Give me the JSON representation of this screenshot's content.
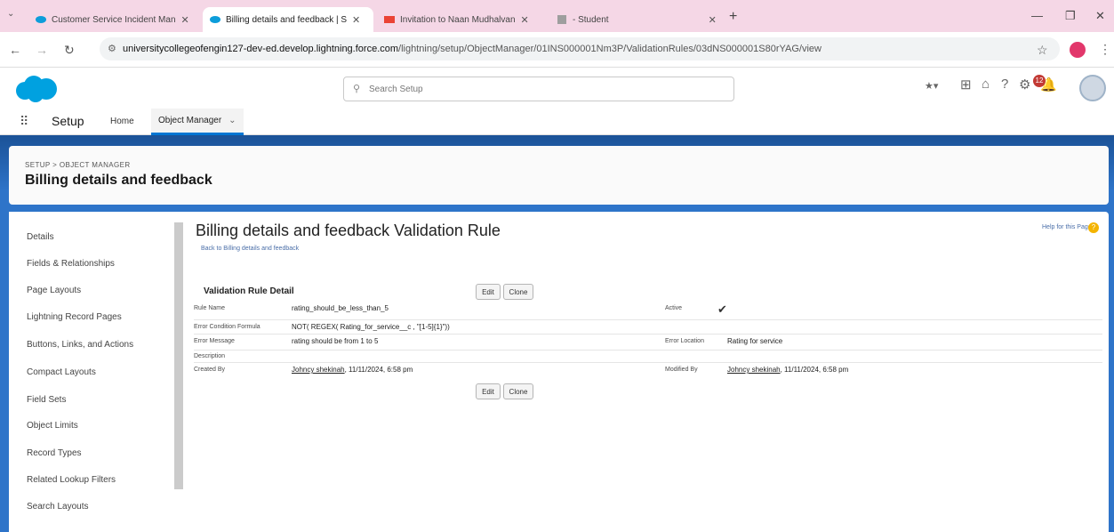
{
  "browser": {
    "tabs": [
      {
        "title": "Customer Service Incident Man",
        "active": false
      },
      {
        "title": "Billing details and feedback | S",
        "active": true
      },
      {
        "title": "Invitation to Naan Mudhalvan",
        "active": false
      },
      {
        "title": "- Student",
        "active": false
      }
    ],
    "url_host": "universitycollegeofengin127-dev-ed.develop.lightning.force.com",
    "url_path": "/lightning/setup/ObjectManager/01INS000001Nm3P/ValidationRules/03dNS000001S80rYAG/view"
  },
  "header": {
    "search_placeholder": "Search Setup",
    "notification_count": "12"
  },
  "appnav": {
    "app_name": "Setup",
    "home": "Home",
    "object_manager": "Object Manager"
  },
  "object_header": {
    "breadcrumb": "SETUP > OBJECT MANAGER",
    "title": "Billing details and feedback"
  },
  "sidebar": {
    "items": [
      "Details",
      "Fields & Relationships",
      "Page Layouts",
      "Lightning Record Pages",
      "Buttons, Links, and Actions",
      "Compact Layouts",
      "Field Sets",
      "Object Limits",
      "Record Types",
      "Related Lookup Filters",
      "Search Layouts"
    ]
  },
  "page": {
    "title": "Billing details and feedback Validation Rule",
    "back_link": "Back to Billing details and feedback",
    "help_link": "Help for this Page",
    "section_title": "Validation Rule Detail",
    "edit_label": "Edit",
    "clone_label": "Clone"
  },
  "detail": {
    "rule_name_label": "Rule Name",
    "rule_name": "rating_should_be_less_than_5",
    "active_label": "Active",
    "formula_label": "Error Condition Formula",
    "formula": "NOT( REGEX( Rating_for_service__c , \"[1-5]{1}\"))",
    "error_message_label": "Error Message",
    "error_message": "rating should be from 1 to 5",
    "error_location_label": "Error Location",
    "error_location": "Rating for service",
    "description_label": "Description",
    "created_by_label": "Created By",
    "created_by_user": "Johncy shekinah",
    "created_by_date": ", 11/11/2024, 6:58 pm",
    "modified_by_label": "Modified By",
    "modified_by_user": "Johncy shekinah",
    "modified_by_date": ", 11/11/2024, 6:58 pm"
  },
  "colors": {
    "brand_blue": "#0176d3",
    "band_blue": "#2e74c9"
  }
}
